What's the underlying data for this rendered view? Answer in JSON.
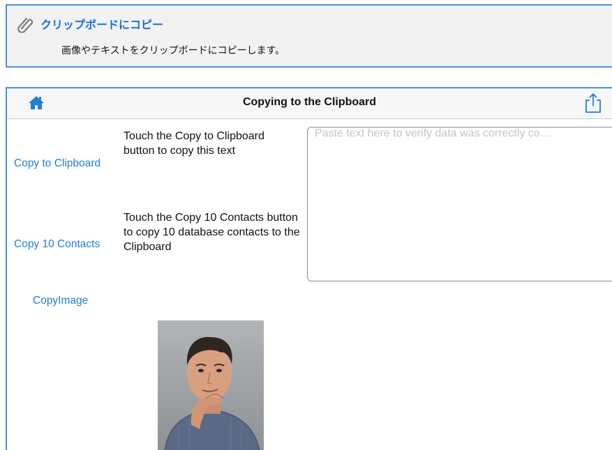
{
  "banner": {
    "title": "クリップボードにコピー",
    "description": "画像やテキストをクリップボードにコピーします。"
  },
  "navbar": {
    "title": "Copying to the Clipboard"
  },
  "actions": [
    {
      "label": "Copy to Clipboard",
      "description": "Touch the Copy to Clipboard button to copy this text"
    },
    {
      "label": "Copy 10 Contacts",
      "description": "Touch the Copy 10 Contacts button to copy 10 database contacts to the Clipboard"
    },
    {
      "label": "CopyImage"
    }
  ],
  "paste_field": {
    "placeholder": "Paste text here to verify data was correctly co…"
  },
  "colors": {
    "accent": "#1f7fd6",
    "banner_border": "#4a8fe0",
    "banner_bg": "#f2f2f2"
  },
  "icons": [
    "paperclip-icon",
    "home-icon",
    "share-icon"
  ]
}
